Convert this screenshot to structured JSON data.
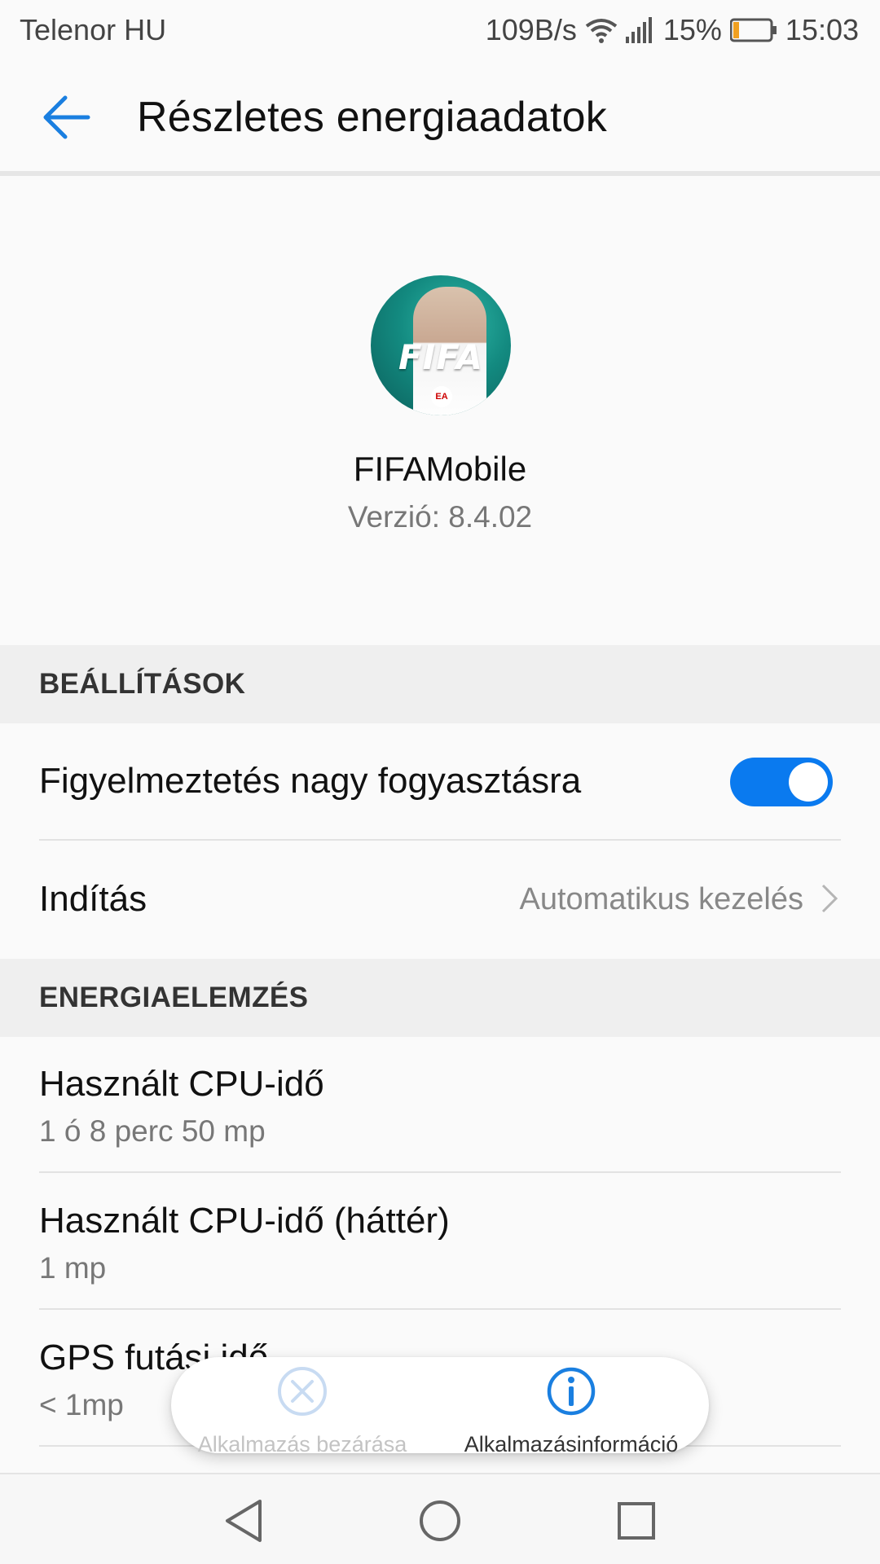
{
  "status_bar": {
    "carrier": "Telenor HU",
    "net_speed": "109B/s",
    "battery_percent": "15%",
    "time": "15:03",
    "icons": [
      "wifi-icon",
      "signal-icon",
      "battery-icon"
    ],
    "battery_level": 0.15,
    "battery_color": "#f0a020"
  },
  "app_bar": {
    "title": "Részletes energiaadatok",
    "back_icon": "arrow-left-icon",
    "accent": "#1a7fe0"
  },
  "app": {
    "name": "FIFAMobile",
    "version": "Verzió: 8.4.02",
    "icon_wordmark": "FIFA",
    "icon_badge": "EA"
  },
  "sections": {
    "settings": {
      "header": "BEÁLLÍTÁSOK",
      "high_usage_warning": {
        "label": "Figyelmeztetés nagy fogyasztásra",
        "enabled": true
      },
      "launch": {
        "label": "Indítás",
        "value": "Automatikus kezelés"
      }
    },
    "energy": {
      "header": "ENERGIAELEMZÉS",
      "items": [
        {
          "label": "Használt CPU-idő",
          "value": "1 ó 8 perc 50 mp"
        },
        {
          "label": "Használt CPU-idő (háttér)",
          "value": "1 mp"
        },
        {
          "label": "GPS futási idő",
          "value": "< 1mp"
        }
      ]
    }
  },
  "popup": {
    "close_label": "Alkalmazás bezárása",
    "info_label": "Alkalmazásinformáció",
    "info_color": "#1a7fe0"
  },
  "nav": {
    "icons": [
      "nav-back-icon",
      "nav-home-icon",
      "nav-recents-icon"
    ]
  },
  "toggle_color": "#0a7aef"
}
